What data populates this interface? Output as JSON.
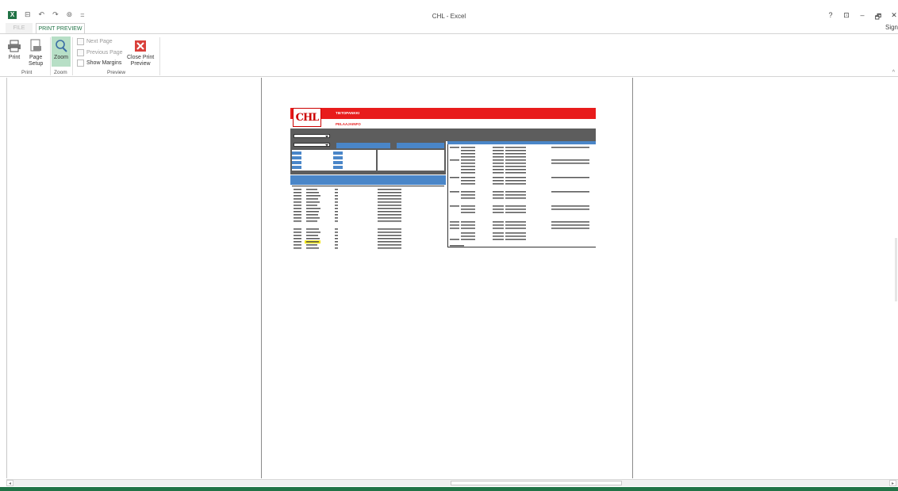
{
  "window": {
    "title": "CHL - Excel",
    "help": "?",
    "ribbon_display": "⊡",
    "minimize": "–",
    "restore": "🗗",
    "close": "✕",
    "signin": "Sign"
  },
  "qat": {
    "excel_logo": "X",
    "save": "⊟",
    "undo": "↶",
    "redo": "↷",
    "touch": "⊚",
    "customize": "="
  },
  "tabs": {
    "file": "FILE",
    "print_preview": "PRINT PREVIEW"
  },
  "ribbon": {
    "print": "Print",
    "page_setup_line1": "Page",
    "page_setup_line2": "Setup",
    "zoom": "Zoom",
    "next_page": "Next Page",
    "previous_page": "Previous Page",
    "show_margins": "Show Margins",
    "close_preview_line1": "Close Print",
    "close_preview_line2": "Preview",
    "group_print": "Print",
    "group_zoom": "Zoom",
    "group_preview": "Preview",
    "collapse": "^"
  },
  "page": {
    "banner_title": "TIETOPANKKI",
    "banner_subtitle": "PELAAJAINFO",
    "logo_text": "CHL",
    "button1": "",
    "button2": ""
  },
  "scroll": {
    "left": "◂",
    "right": "▸"
  },
  "colors": {
    "accent": "#217346",
    "banner_red": "#e81c1c",
    "header_blue": "#4a86c8",
    "panel_gray": "#5d5d5d"
  }
}
